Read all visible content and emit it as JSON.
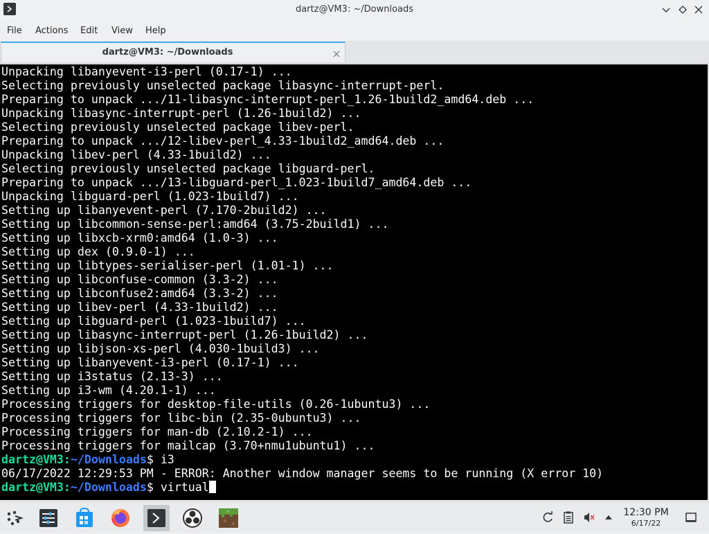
{
  "window": {
    "title": "dartz@VM3: ~/Downloads"
  },
  "menu": {
    "file": "File",
    "actions": "Actions",
    "edit": "Edit",
    "view": "View",
    "help": "Help"
  },
  "tab": {
    "label": "dartz@VM3: ~/Downloads"
  },
  "terminal": {
    "lines": [
      "Unpacking libanyevent-i3-perl (0.17-1) ...",
      "Selecting previously unselected package libasync-interrupt-perl.",
      "Preparing to unpack .../11-libasync-interrupt-perl_1.26-1build2_amd64.deb ...",
      "Unpacking libasync-interrupt-perl (1.26-1build2) ...",
      "Selecting previously unselected package libev-perl.",
      "Preparing to unpack .../12-libev-perl_4.33-1build2_amd64.deb ...",
      "Unpacking libev-perl (4.33-1build2) ...",
      "Selecting previously unselected package libguard-perl.",
      "Preparing to unpack .../13-libguard-perl_1.023-1build7_amd64.deb ...",
      "Unpacking libguard-perl (1.023-1build7) ...",
      "Setting up libanyevent-perl (7.170-2build2) ...",
      "Setting up libcommon-sense-perl:amd64 (3.75-2build1) ...",
      "Setting up libxcb-xrm0:amd64 (1.0-3) ...",
      "Setting up dex (0.9.0-1) ...",
      "Setting up libtypes-serialiser-perl (1.01-1) ...",
      "Setting up libconfuse-common (3.3-2) ...",
      "Setting up libconfuse2:amd64 (3.3-2) ...",
      "Setting up libev-perl (4.33-1build2) ...",
      "Setting up libguard-perl (1.023-1build7) ...",
      "Setting up libasync-interrupt-perl (1.26-1build2) ...",
      "Setting up libjson-xs-perl (4.030-1build3) ...",
      "Setting up libanyevent-i3-perl (0.17-1) ...",
      "Setting up i3status (2.13-3) ...",
      "Setting up i3-wm (4.20.1-1) ...",
      "Processing triggers for desktop-file-utils (0.26-1ubuntu3) ...",
      "Processing triggers for libc-bin (2.35-0ubuntu3) ...",
      "Processing triggers for man-db (2.10.2-1) ...",
      "Processing triggers for mailcap (3.70+nmu1ubuntu1) ..."
    ],
    "prompt1": {
      "user": "dartz@VM3",
      "sep": ":",
      "path": "~/Downloads",
      "symbol": "$ ",
      "command": "i3"
    },
    "error_line": "06/17/2022 12:29:53 PM - ERROR: Another window manager seems to be running (X error 10)",
    "prompt2": {
      "user": "dartz@VM3",
      "sep": ":",
      "path": "~/Downloads",
      "symbol": "$ ",
      "command": "virtual"
    }
  },
  "taskbar": {
    "apps": [
      "application-launcher-icon",
      "system-settings-icon",
      "discover-store-icon",
      "firefox-icon",
      "konsole-terminal-icon",
      "obs-studio-icon",
      "minecraft-icon"
    ],
    "clock_time": "12:30 PM",
    "clock_date": "6/17/22"
  },
  "colors": {
    "prompt_user": "#1cdc9a",
    "prompt_path": "#3d7bff",
    "accent": "#3daee9"
  }
}
